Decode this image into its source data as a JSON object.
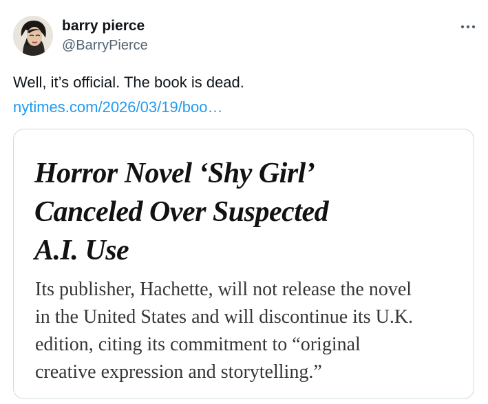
{
  "author": {
    "display_name": "barry pierce",
    "handle": "@BarryPierce",
    "avatar_icon": "profile-photo"
  },
  "more_icon": "more-horizontal-icon",
  "tweet": {
    "text": "Well, it’s official. The book is dead.",
    "link": "nytimes.com/2026/03/19/boo…"
  },
  "card": {
    "headline_lines": [
      "Horror Novel ‘Shy Girl’",
      "Canceled Over Suspected",
      "A.I. Use"
    ],
    "summary_lines": [
      "Its publisher, Hachette, will not release the novel",
      "in the United States and will discontinue its U.K.",
      "edition, citing its commitment to “original",
      "creative expression and storytelling.”"
    ]
  },
  "colors": {
    "link": "#1d9bf0",
    "secondary_text": "#536471",
    "border": "#cfd9de"
  }
}
